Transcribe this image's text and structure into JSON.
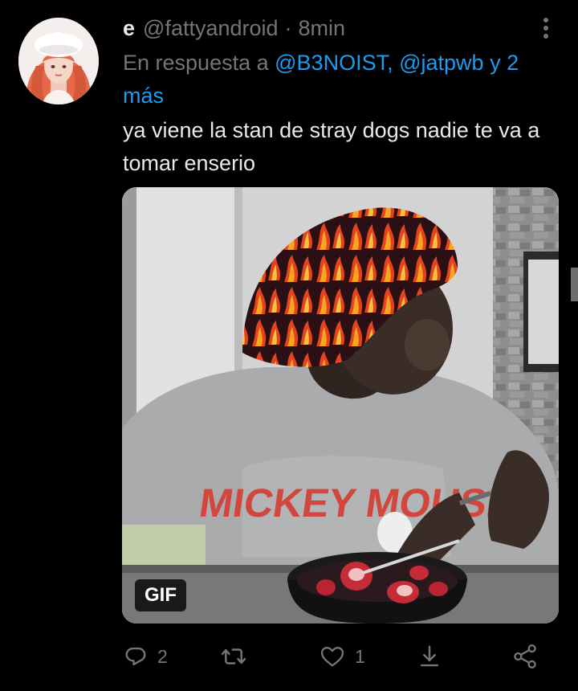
{
  "tweet": {
    "display_name": "e",
    "handle": "@fattyandroid",
    "separator": "·",
    "time": "8min",
    "reply_prefix": "En respuesta a",
    "reply_mentions": [
      "@B3NOIST,",
      "@jatpwb"
    ],
    "reply_suffix": "y 2 más",
    "text": "ya viene la stan de stray dogs nadie te va a tomar enserio",
    "media_badge": "GIF",
    "media_print": "MICKEY MOUSE"
  },
  "actions": {
    "reply": {
      "icon": "reply-icon",
      "count": "2"
    },
    "retweet": {
      "icon": "retweet-icon",
      "count": ""
    },
    "like": {
      "icon": "heart-icon",
      "count": "1"
    },
    "share": {
      "icon": "share-icon"
    },
    "network": {
      "icon": "share-network-icon"
    }
  },
  "colors": {
    "background": "#000000",
    "text": "#e7e9ea",
    "secondary": "#71767b",
    "link": "#1d9bf0"
  }
}
